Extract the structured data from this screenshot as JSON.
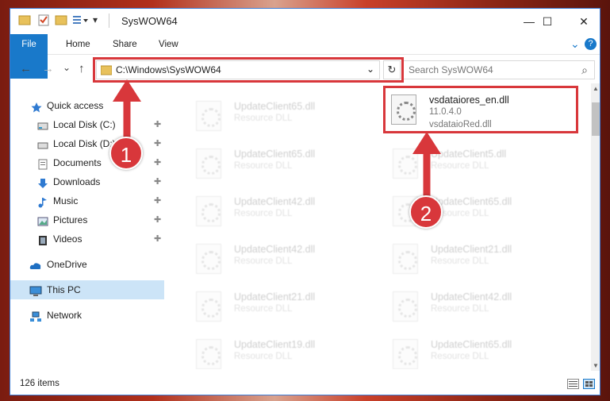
{
  "window": {
    "title": "SysWOW64",
    "minimize_icon": "—",
    "maximize_icon": "☐",
    "close_icon": "✕"
  },
  "ribbon": {
    "tabs": [
      "File",
      "Home",
      "Share",
      "View"
    ],
    "collapse_icon": "⌄",
    "help_icon": "?"
  },
  "address": {
    "back": "←",
    "forward": "→",
    "recent": "⌄",
    "up": "↑",
    "path": "C:\\Windows\\SysWOW64",
    "dropdown": "⌄",
    "refresh": "↻",
    "search_placeholder": "Search SysWOW64",
    "search_icon": "⌕"
  },
  "nav": {
    "items": [
      {
        "label": "Quick access",
        "pinned": false
      },
      {
        "label": "Local Disk (C:)",
        "pinned": true
      },
      {
        "label": "Local Disk (D:)",
        "pinned": true
      },
      {
        "label": "Documents",
        "pinned": true
      },
      {
        "label": "Downloads",
        "pinned": true
      },
      {
        "label": "Music",
        "pinned": true
      },
      {
        "label": "Pictures",
        "pinned": true
      },
      {
        "label": "Videos",
        "pinned": true
      },
      {
        "label": "OneDrive",
        "pinned": false
      },
      {
        "label": "This PC",
        "pinned": false,
        "selected": true
      },
      {
        "label": "Network",
        "pinned": false
      }
    ],
    "pin_icon": "📌"
  },
  "files": {
    "highlighted": {
      "name": "vsdataiores_en.dll",
      "version": "11.0.4.0",
      "description": "vsdataioRed.dll"
    },
    "left_column": [
      {
        "name": "UpdateClient65.dll",
        "desc": "Resource DLL"
      },
      {
        "name": "UpdateClient65.dll",
        "desc": "Resource DLL"
      },
      {
        "name": "UpdateClient42.dll",
        "desc": "Resource DLL"
      },
      {
        "name": "UpdateClient42.dll",
        "desc": "Resource DLL"
      },
      {
        "name": "UpdateClient21.dll",
        "desc": "Resource DLL"
      },
      {
        "name": "UpdateClient19.dll",
        "desc": "Resource DLL"
      }
    ],
    "right_column": [
      {
        "name": "UpdateClient5.dll",
        "desc": "Resource DLL"
      },
      {
        "name": "UpdateClient65.dll",
        "desc": "Resource DLL"
      },
      {
        "name": "UpdateClient21.dll",
        "desc": "Resource DLL"
      },
      {
        "name": "UpdateClient42.dll",
        "desc": "Resource DLL"
      },
      {
        "name": "UpdateClient65.dll",
        "desc": "Resource DLL"
      }
    ]
  },
  "status": {
    "item_count": "126 items"
  },
  "annotations": {
    "badge1": "1",
    "badge2": "2",
    "color": "#d8373b"
  }
}
